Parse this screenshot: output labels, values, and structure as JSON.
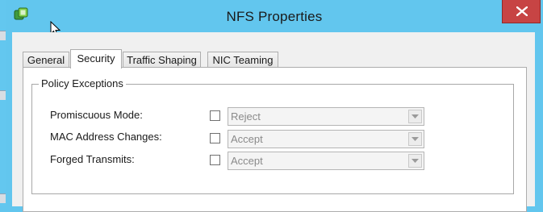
{
  "window": {
    "title": "NFS Properties",
    "close_glyph": "X"
  },
  "tabs": [
    {
      "label": "General",
      "active": false
    },
    {
      "label": "Security",
      "active": true
    },
    {
      "label": "Traffic Shaping",
      "active": false
    },
    {
      "label": "NIC Teaming",
      "active": false
    }
  ],
  "policy": {
    "group_label": "Policy Exceptions",
    "rows": [
      {
        "label": "Promiscuous Mode:",
        "checked": false,
        "value": "Reject"
      },
      {
        "label": "MAC Address Changes:",
        "checked": false,
        "value": "Accept"
      },
      {
        "label": "Forged Transmits:",
        "checked": false,
        "value": "Accept"
      }
    ]
  },
  "icons": {
    "app": "vsphere-app-icon",
    "cursor": "mouse-cursor-icon",
    "dropdown": "chevron-down-icon"
  },
  "colors": {
    "titlebar": "#62c6ee",
    "close_button": "#c74444",
    "client": "#f0f0f0",
    "panel": "#ffffff"
  }
}
